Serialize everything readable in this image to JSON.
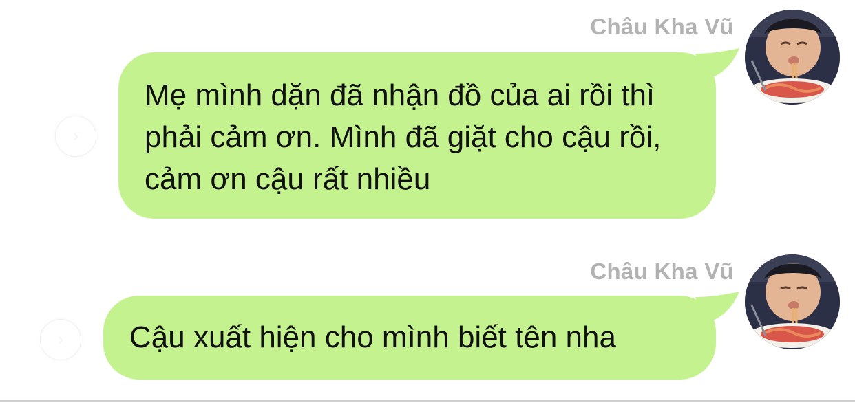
{
  "colors": {
    "bubble": "#c3f28f",
    "sender_name": "#b3b3b3",
    "text": "#111111",
    "background": "#ffffff"
  },
  "messages": [
    {
      "sender": "Châu Kha Vũ",
      "text": "Mẹ mình dặn đã nhận đồ của ai rồi thì phải cảm ơn. Mình đã giặt cho cậu rồi, cảm ơn cậu rất nhiều",
      "avatar": "avatar-photo-child-eating-noodles"
    },
    {
      "sender": "Châu Kha Vũ",
      "text": "Cậu xuất hiện cho mình biết tên nha",
      "avatar": "avatar-photo-child-eating-noodles"
    }
  ],
  "icons": {
    "reply_action": "share-icon"
  }
}
